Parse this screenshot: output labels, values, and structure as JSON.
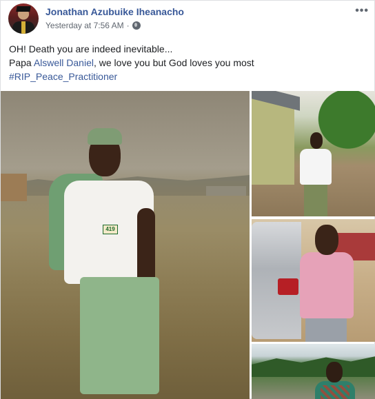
{
  "post": {
    "author_name": "Jonathan Azubuike Iheanacho",
    "timestamp": "Yesterday at 7:56 AM",
    "separator": "·",
    "privacy_icon": "globe-icon",
    "more_icon": "more-options-icon",
    "more_label": "•••",
    "text": {
      "line1": "OH! Death you are indeed inevitable...",
      "line2_prefix": "Papa ",
      "line2_mention": "Alswell Daniel",
      "line2_suffix": ", we love you but God loves you most",
      "hashtag": "#RIP_Peace_Practitioner"
    },
    "photo_badge_text": "419"
  },
  "colors": {
    "link": "#385898",
    "text": "#1c1e21",
    "meta": "#606770"
  }
}
